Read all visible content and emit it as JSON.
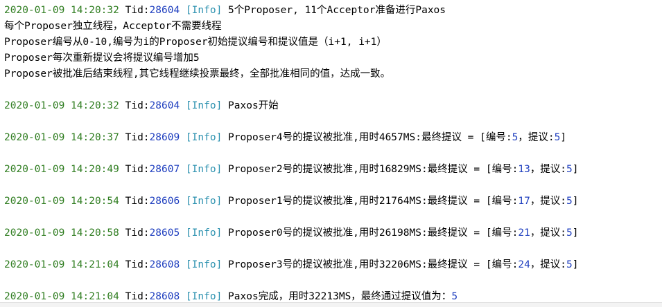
{
  "console": {
    "header": {
      "timestamp": "2020-01-09 14:20:32",
      "tid_label": "Tid:",
      "tid": "28604",
      "level": "[Info]",
      "message": "5个Proposer, 11个Acceptor准备进行Paxos"
    },
    "intro_lines": [
      "每个Proposer独立线程，Acceptor不需要线程",
      "Proposer编号从0-10,编号为i的Proposer初始提议编号和提议值是（i+1, i+1）",
      "Proposer每次重新提议会将提议编号增加5",
      "Proposer被批准后结束线程,其它线程继续投票最终，全部批准相同的值，达成一致。"
    ],
    "start": {
      "timestamp": "2020-01-09 14:20:32",
      "tid_label": "Tid:",
      "tid": "28604",
      "level": "[Info]",
      "message": "Paxos开始"
    },
    "approvals": [
      {
        "timestamp": "2020-01-09 14:20:37",
        "tid_label": "Tid:",
        "tid": "28609",
        "level": "[Info]",
        "prefix": "Proposer4号的提议被批准,用时4657MS:最终提议 = [编号:",
        "number": "5",
        "mid": "，提议:",
        "value": "5",
        "suffix": "]"
      },
      {
        "timestamp": "2020-01-09 14:20:49",
        "tid_label": "Tid:",
        "tid": "28607",
        "level": "[Info]",
        "prefix": "Proposer2号的提议被批准,用时16829MS:最终提议 = [编号:",
        "number": "13",
        "mid": "，提议:",
        "value": "5",
        "suffix": "]"
      },
      {
        "timestamp": "2020-01-09 14:20:54",
        "tid_label": "Tid:",
        "tid": "28606",
        "level": "[Info]",
        "prefix": "Proposer1号的提议被批准,用时21764MS:最终提议 = [编号:",
        "number": "17",
        "mid": "，提议:",
        "value": "5",
        "suffix": "]"
      },
      {
        "timestamp": "2020-01-09 14:20:58",
        "tid_label": "Tid:",
        "tid": "28605",
        "level": "[Info]",
        "prefix": "Proposer0号的提议被批准,用时26198MS:最终提议 = [编号:",
        "number": "21",
        "mid": "，提议:",
        "value": "5",
        "suffix": "]"
      },
      {
        "timestamp": "2020-01-09 14:21:04",
        "tid_label": "Tid:",
        "tid": "28608",
        "level": "[Info]",
        "prefix": "Proposer3号的提议被批准,用时32206MS:最终提议 = [编号:",
        "number": "24",
        "mid": "，提议:",
        "value": "5",
        "suffix": "]"
      }
    ],
    "final": {
      "timestamp": "2020-01-09 14:21:04",
      "tid_label": "Tid:",
      "tid": "28608",
      "level": "[Info]",
      "message": "Paxos完成，用时32213MS，最终通过提议值为：",
      "value": "5"
    }
  }
}
